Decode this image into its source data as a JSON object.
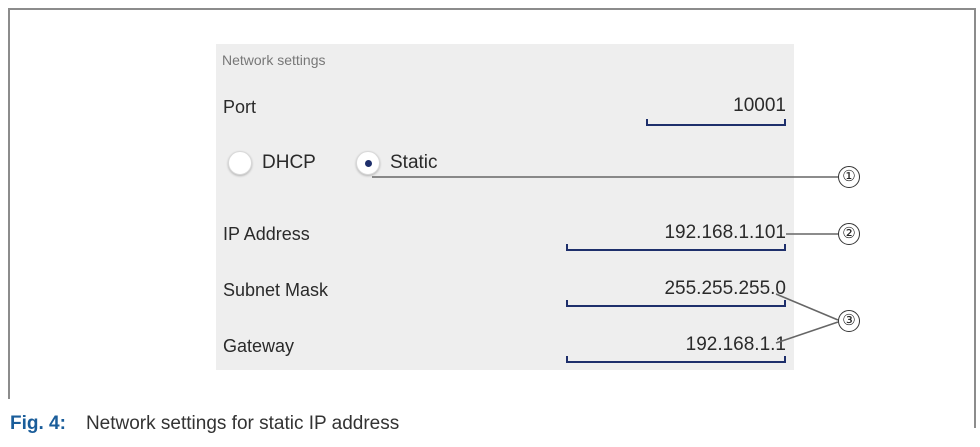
{
  "panel": {
    "title": "Network settings",
    "port": {
      "label": "Port",
      "value": "10001"
    },
    "mode": {
      "options": [
        {
          "label": "DHCP",
          "selected": false
        },
        {
          "label": "Static",
          "selected": true
        }
      ]
    },
    "ip_address": {
      "label": "IP Address",
      "value": "192.168.1.101"
    },
    "subnet_mask": {
      "label": "Subnet Mask",
      "value": "255.255.255.0"
    },
    "gateway": {
      "label": "Gateway",
      "value": "192.168.1.1"
    }
  },
  "callouts": {
    "one": "①",
    "two": "②",
    "three": "③"
  },
  "caption": {
    "fig": "Fig. 4:",
    "text": "Network settings for static IP address"
  },
  "colors": {
    "accent": "#1e2f6b",
    "caption_fig": "#1a5d9a",
    "panel_bg": "#eeeeee"
  }
}
